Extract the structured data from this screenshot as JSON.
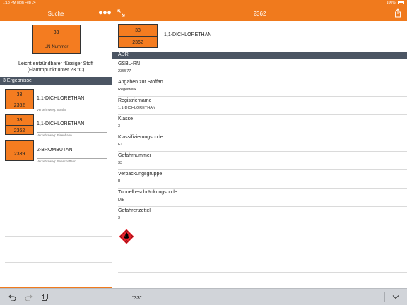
{
  "status_bar": {
    "time_date": "1:18 PM  Mon Feb 24",
    "battery": "100%"
  },
  "left_nav": {
    "title": "Suche",
    "more_icon": "more-icon"
  },
  "right_nav": {
    "title": "2362",
    "expand_icon": "expand-icon",
    "share_icon": "share-icon"
  },
  "search_plate": {
    "top": "33",
    "bottom": "UN-Nummer"
  },
  "search_description": [
    "Leicht entzündbarer flüssiger Stoff",
    "(Flammpunkt unter 23 °C)"
  ],
  "results_header": "3 Ergebnisse",
  "results": [
    {
      "top": "33",
      "bottom": "2362",
      "name": "1,1-DICHLORETHAN",
      "route": "Verkehrsweg: Straße"
    },
    {
      "top": "33",
      "bottom": "2362",
      "name": "1,1-DICHLORETHAN",
      "route": "Verkehrsweg: Eisenbahn"
    },
    {
      "top": "",
      "bottom": "2339",
      "name": "2-BROMBUTAN",
      "route": "Verkehrsweg: Seeschifffahrt"
    }
  ],
  "detail": {
    "plate_top": "33",
    "plate_bottom": "2362",
    "name": "1,1-DICHLORETHAN",
    "section": "ADR",
    "fields": [
      {
        "label": "GSBL-RN",
        "value": "235577"
      },
      {
        "label": "Angaben zur Stoffart",
        "value": "Regelwerk"
      },
      {
        "label": "Registriername",
        "value": "1,1-DICHLORETHAN"
      },
      {
        "label": "Klasse",
        "value": "3"
      },
      {
        "label": "Klassifizierungscode",
        "value": "F1"
      },
      {
        "label": "Gefahrnummer",
        "value": "33"
      },
      {
        "label": "Verpackungsgruppe",
        "value": "II"
      },
      {
        "label": "Tunnelbeschränkungscode",
        "value": "D/E"
      },
      {
        "label": "Gefahrenzettel",
        "value": "3"
      }
    ],
    "hazard_icon": "flammable-hazard-icon"
  },
  "keyboard_bar": {
    "prediction": "“33”",
    "icons": [
      "undo-icon",
      "redo-icon",
      "clipboard-icon",
      "chevron-down-icon"
    ]
  },
  "colors": {
    "accent": "#f07a1d",
    "plate": "#f47c20",
    "section": "#4b5563",
    "hazard": "#e8202a"
  }
}
